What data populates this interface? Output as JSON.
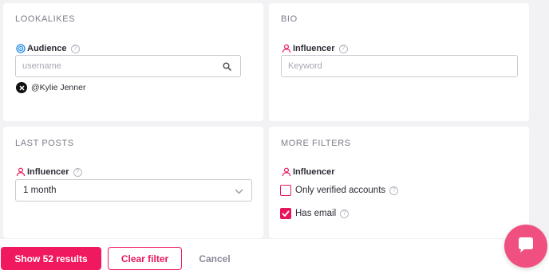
{
  "lookalikes": {
    "title": "LOOKALIKES",
    "audience_label": "Audience",
    "search_placeholder": "username",
    "selected_chip": "@Kylie Jenner"
  },
  "bio": {
    "title": "BIO",
    "influencer_label": "Influencer",
    "keyword_placeholder": "Keyword"
  },
  "last_posts": {
    "title": "LAST POSTS",
    "influencer_label": "Influencer",
    "period_value": "1 month"
  },
  "more_filters": {
    "title": "MORE FILTERS",
    "influencer_label": "Influencer",
    "verified_label": "Only verified accounts",
    "verified_checked": false,
    "email_label": "Has email",
    "email_checked": true
  },
  "footer": {
    "show_results_label": "Show 52 results",
    "clear_filter_label": "Clear filter",
    "cancel_label": "Cancel"
  },
  "colors": {
    "accent": "#f0185f",
    "audience_icon": "#1e88e5",
    "chat_bubble": "#f0507f"
  },
  "icons": {
    "audience": "target-icon",
    "influencer": "person-icon",
    "help": "help-icon",
    "search": "search-icon",
    "remove": "close-icon",
    "dropdown": "chevron-down-icon",
    "chat": "chat-icon"
  }
}
